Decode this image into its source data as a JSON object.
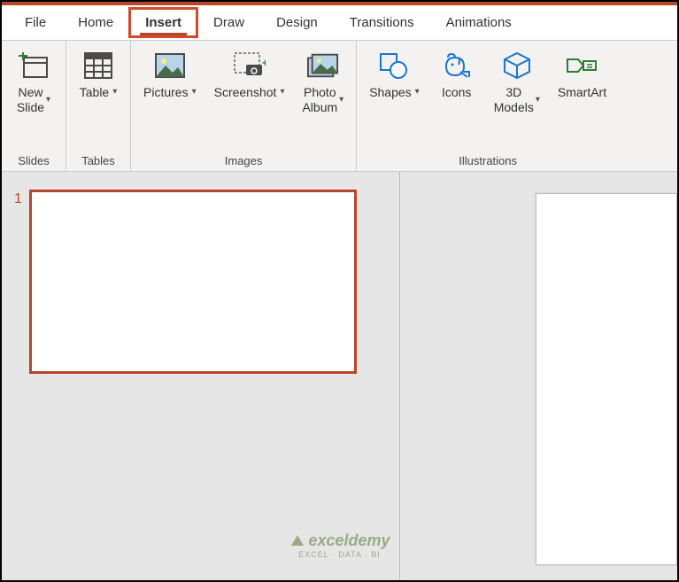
{
  "tabs": {
    "file": "File",
    "home": "Home",
    "insert": "Insert",
    "draw": "Draw",
    "design": "Design",
    "transitions": "Transitions",
    "animations": "Animations"
  },
  "ribbon": {
    "slides": {
      "group_label": "Slides",
      "new_slide": "New\nSlide"
    },
    "tables": {
      "group_label": "Tables",
      "table": "Table"
    },
    "images": {
      "group_label": "Images",
      "pictures": "Pictures",
      "screenshot": "Screenshot",
      "photo_album": "Photo\nAlbum"
    },
    "illustrations": {
      "group_label": "Illustrations",
      "shapes": "Shapes",
      "icons": "Icons",
      "models_3d": "3D\nModels",
      "smartart": "SmartArt"
    }
  },
  "slide": {
    "number": "1"
  },
  "watermark": {
    "name": "exceldemy",
    "sub": "EXCEL · DATA · BI"
  }
}
